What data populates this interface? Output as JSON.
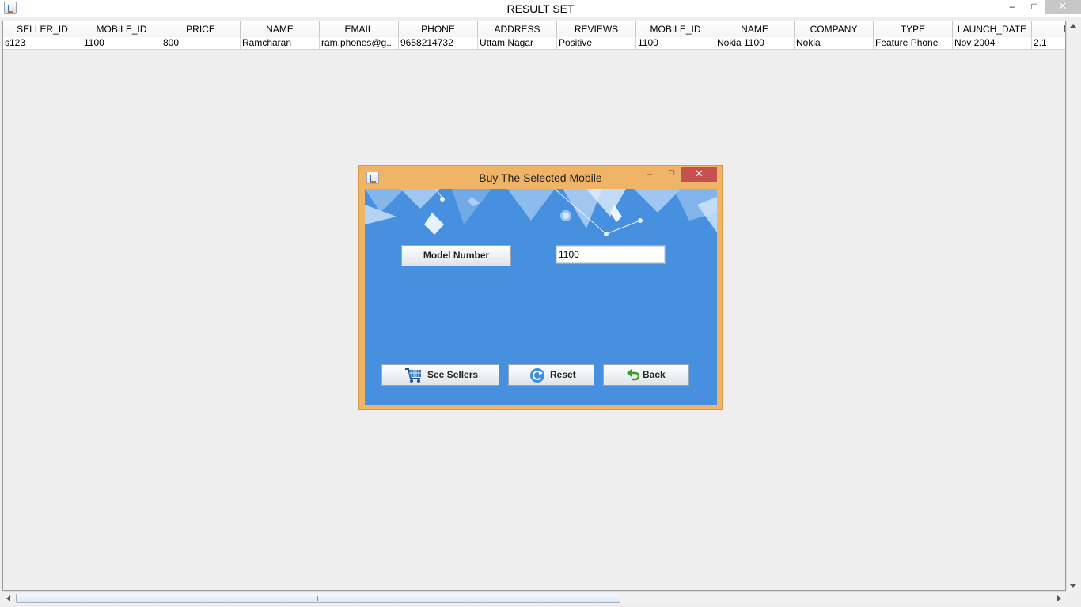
{
  "window": {
    "title": "RESULT SET",
    "controls": {
      "minimize": "–",
      "maximize": "□",
      "close": "✕"
    }
  },
  "table": {
    "columns": [
      "SELLER_ID",
      "MOBILE_ID",
      "PRICE",
      "NAME",
      "EMAIL",
      "PHONE",
      "ADDRESS",
      "REVIEWS",
      "MOBILE_ID",
      "NAME",
      "COMPANY",
      "TYPE",
      "LAUNCH_DATE",
      "DIS"
    ],
    "rows": [
      [
        "s123",
        "1100",
        "800",
        "Ramcharan",
        "ram.phones@g...",
        "9658214732",
        "Uttam Nagar",
        "Positive",
        "1100",
        "Nokia 1100",
        "Nokia",
        "Feature Phone",
        "Nov 2004",
        "2.1"
      ]
    ]
  },
  "dialog": {
    "title": "Buy The Selected Mobile",
    "controls": {
      "minimize": "–",
      "maximize": "□",
      "close": "✕"
    },
    "model_label": "Model Number",
    "model_value": "1100",
    "buttons": {
      "sellers": "See Sellers",
      "reset": "Reset",
      "back": "Back"
    },
    "icons": {
      "sellers": "cart-icon",
      "reset": "refresh-icon",
      "back": "back-arrow-icon"
    }
  },
  "colors": {
    "dialog_frame": "#f0b466",
    "dialog_body": "#4690df",
    "close_button": "#c75050",
    "window_background": "#eeeeee"
  }
}
